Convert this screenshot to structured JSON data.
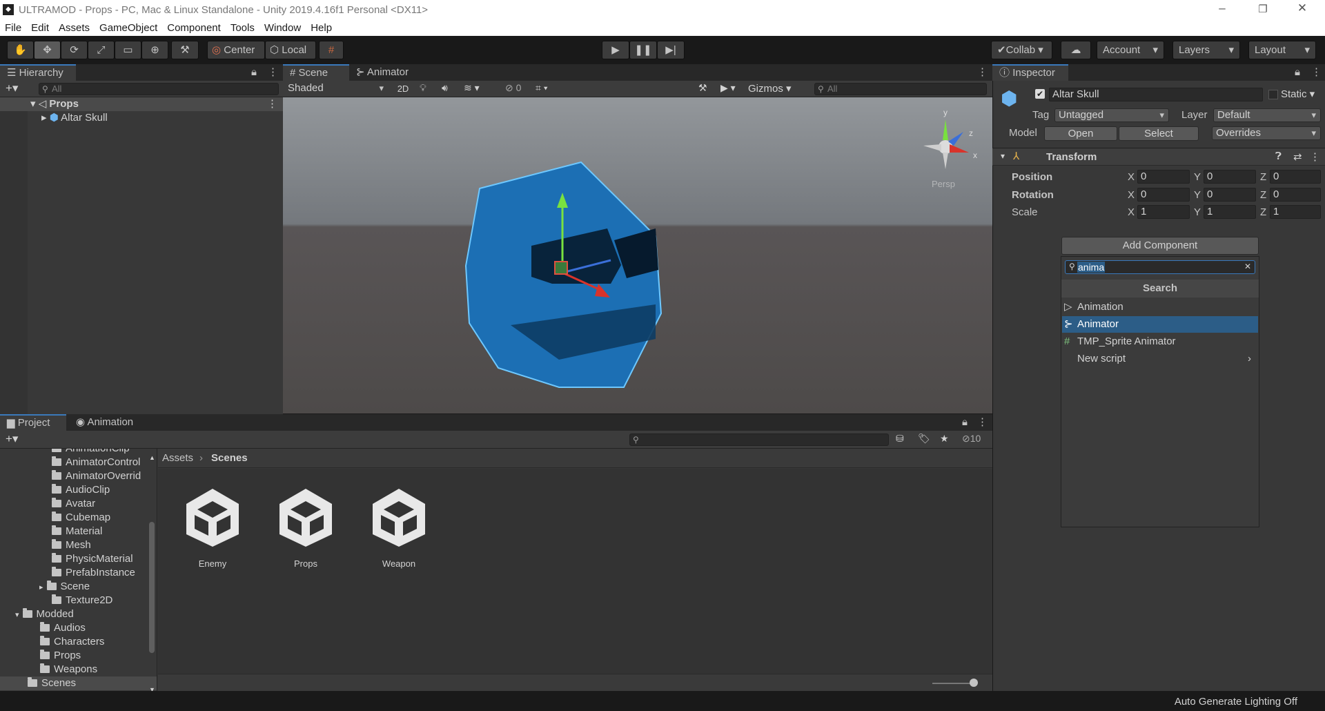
{
  "window": {
    "title": "ULTRAMOD - Props - PC, Mac & Linux Standalone - Unity 2019.4.16f1 Personal <DX11>"
  },
  "menu": [
    "File",
    "Edit",
    "Assets",
    "GameObject",
    "Component",
    "Tools",
    "Window",
    "Help"
  ],
  "toolbar": {
    "center_label": "Center",
    "local_label": "Local",
    "collab_label": "Collab",
    "account_label": "Account",
    "layers_label": "Layers",
    "layout_label": "Layout"
  },
  "hierarchy": {
    "tab": "Hierarchy",
    "search_placeholder": "All",
    "scene": "Props",
    "object": "Altar Skull"
  },
  "scene": {
    "tab_scene": "Scene",
    "tab_animator": "Animator",
    "shading": "Shaded",
    "mode_2d": "2D",
    "hidden_count": "0",
    "gizmos": "Gizmos",
    "search_placeholder": "All",
    "persp": "Persp"
  },
  "inspector": {
    "tab": "Inspector",
    "object_name": "Altar Skull",
    "static_label": "Static",
    "tag_label": "Tag",
    "tag_value": "Untagged",
    "layer_label": "Layer",
    "layer_value": "Default",
    "model_label": "Model",
    "open_label": "Open",
    "select_label": "Select",
    "overrides_label": "Overrides",
    "transform_label": "Transform",
    "position": {
      "label": "Position",
      "x": "0",
      "y": "0",
      "z": "0"
    },
    "rotation": {
      "label": "Rotation",
      "x": "0",
      "y": "0",
      "z": "0"
    },
    "scale": {
      "label": "Scale",
      "x": "1",
      "y": "1",
      "z": "1"
    },
    "add_component_label": "Add Component",
    "component_search": "anima",
    "search_header": "Search",
    "results": [
      "Animation",
      "Animator",
      "TMP_Sprite Animator",
      "New script"
    ]
  },
  "project": {
    "tab_project": "Project",
    "tab_animation": "Animation",
    "hidden_count": "10",
    "breadcrumb": [
      "Assets",
      "Scenes"
    ],
    "tree": [
      "AnimationClip",
      "AnimatorControl",
      "AnimatorOverrid",
      "AudioClip",
      "Avatar",
      "Cubemap",
      "Material",
      "Mesh",
      "PhysicMaterial",
      "PrefabInstance",
      "Scene",
      "Texture2D",
      "Modded",
      "Audios",
      "Characters",
      "Props",
      "Weapons",
      "Scenes"
    ],
    "assets": [
      "Enemy",
      "Props",
      "Weapon"
    ]
  },
  "status": {
    "text": "Auto Generate Lighting Off"
  },
  "colors": {
    "accent": "#3a79bb",
    "selection": "#2c5d87",
    "panel": "#383838",
    "scene_bg_sky": "#6d7175",
    "ground": "#5a5553"
  },
  "axis_labels": {
    "x": "x",
    "y": "y",
    "z": "z"
  }
}
